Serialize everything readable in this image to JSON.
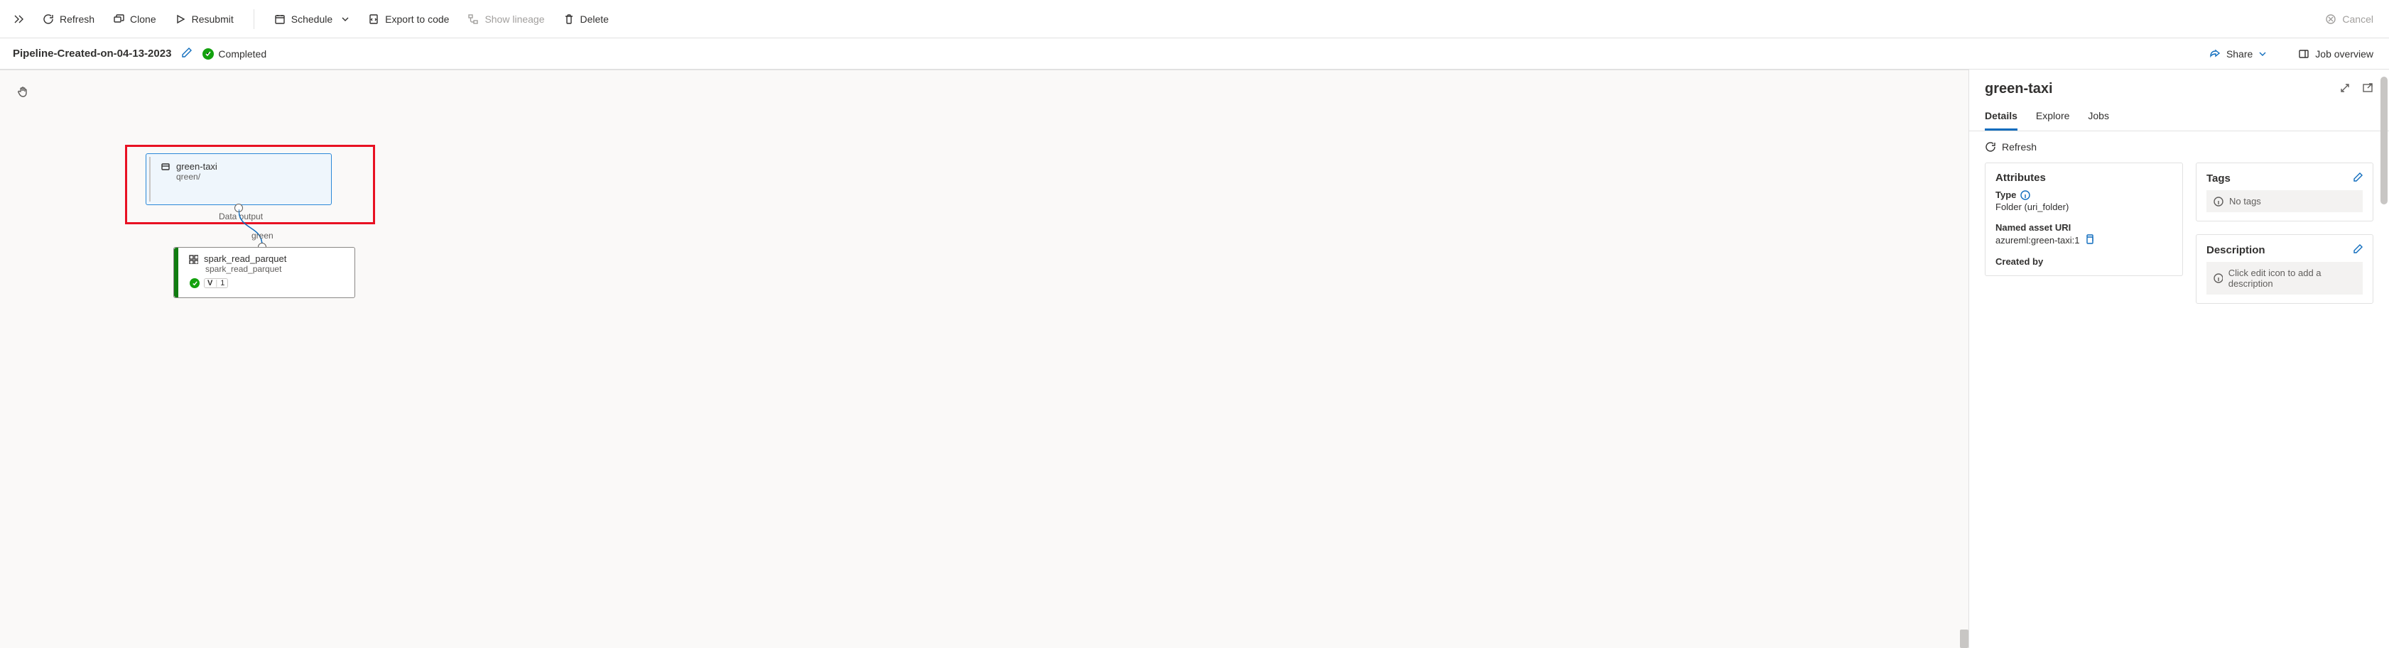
{
  "toolbar": {
    "refresh": "Refresh",
    "clone": "Clone",
    "resubmit": "Resubmit",
    "schedule": "Schedule",
    "export": "Export to code",
    "lineage": "Show lineage",
    "delete": "Delete",
    "cancel": "Cancel"
  },
  "header": {
    "pipeline_name": "Pipeline-Created-on-04-13-2023",
    "status": "Completed",
    "share": "Share",
    "overview": "Job overview"
  },
  "canvas": {
    "node_green": {
      "title": "green-taxi",
      "subtitle": "qreen/",
      "output_label": "Data output"
    },
    "edge_label": "green",
    "node_spark": {
      "title": "spark_read_parquet",
      "subtitle": "spark_read_parquet",
      "v_label": "V",
      "v_value": "1"
    }
  },
  "side": {
    "title": "green-taxi",
    "tabs": {
      "details": "Details",
      "explore": "Explore",
      "jobs": "Jobs"
    },
    "refresh": "Refresh",
    "attributes": {
      "heading": "Attributes",
      "type_label": "Type",
      "type_value": "Folder (uri_folder)",
      "uri_label": "Named asset URI",
      "uri_value": "azureml:green-taxi:1",
      "createdby_label": "Created by"
    },
    "tags": {
      "heading": "Tags",
      "empty": "No tags"
    },
    "description": {
      "heading": "Description",
      "empty": "Click edit icon to add a description"
    }
  }
}
